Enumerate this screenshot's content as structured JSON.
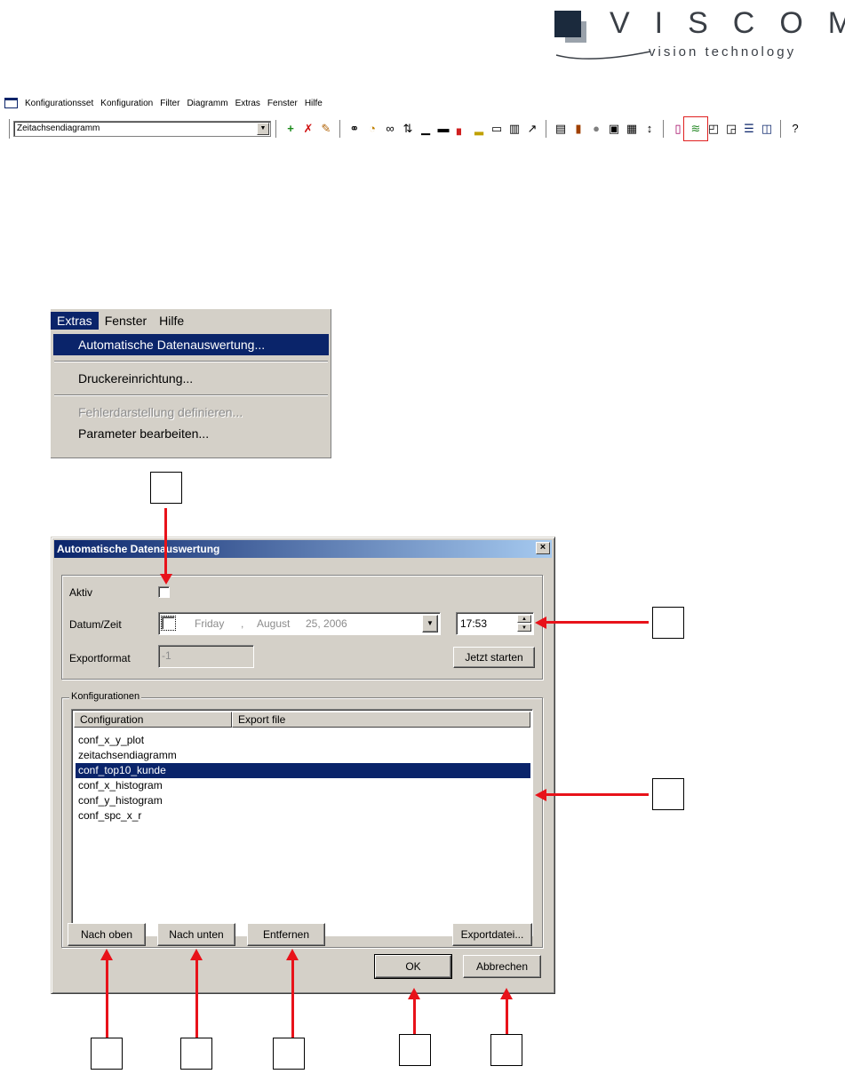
{
  "logo": {
    "word": "VISCOM",
    "tagline": "vision technology"
  },
  "menubar": {
    "items": [
      "Konfigurationsset",
      "Konfiguration",
      "Filter",
      "Diagramm",
      "Extras",
      "Fenster",
      "Hilfe"
    ]
  },
  "toolbar": {
    "combo_value": "Zeitachsendiagramm",
    "icons": [
      "add-icon",
      "delete-icon",
      "edit-icon",
      "binoculars-icon",
      "clock-icon",
      "glasses-icon",
      "sort-icon",
      "chart1-icon",
      "chart2-icon",
      "chart3-icon",
      "chart4-icon",
      "chart5-icon",
      "chart6-icon",
      "chart7-icon",
      "hammer-icon",
      "properties-icon",
      "bar-chart-icon",
      "stop-icon",
      "save-icon",
      "print-icon",
      "updown-icon",
      "page-icon",
      "auto-eval-icon",
      "window1-icon",
      "window2-icon",
      "window3-icon",
      "window4-icon",
      "help-icon"
    ]
  },
  "extras_menu": {
    "bar": [
      "Extras",
      "Fenster",
      "Hilfe"
    ],
    "items": {
      "auto": "Automatische Datenauswertung...",
      "printer": "Druckereinrichtung...",
      "error_def": "Fehlerdarstellung definieren...",
      "params": "Parameter bearbeiten..."
    }
  },
  "dialog": {
    "title": "Automatische Datenauswertung",
    "close": "×",
    "aktiv_label": "Aktiv",
    "datum_label": "Datum/Zeit",
    "date": {
      "weekday": "Friday",
      "sep": ",",
      "month": "August",
      "day_year": "25, 2006"
    },
    "time": "17:53",
    "export_label": "Exportformat",
    "export_value": "-1",
    "jetzt_button": "Jetzt starten",
    "konfig_group": "Konfigurationen",
    "columns": [
      "Configuration",
      "Export file"
    ],
    "rows": [
      "conf_x_y_plot",
      "zeitachsendiagramm",
      "conf_top10_kunde",
      "conf_x_histogram",
      "conf_y_histogram",
      "conf_spc_x_r"
    ],
    "selected_row": 2,
    "buttons": {
      "up": "Nach oben",
      "down": "Nach unten",
      "remove": "Entfernen",
      "exportfile": "Exportdatei...",
      "ok": "OK",
      "cancel": "Abbrechen"
    }
  },
  "colors": {
    "accent": "#0a246a",
    "arrow": "#e8121a",
    "face": "#d4d0c8"
  }
}
